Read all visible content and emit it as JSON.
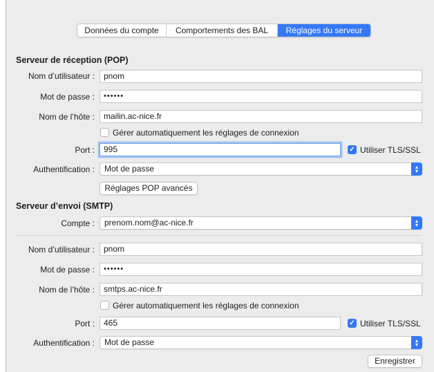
{
  "tabs": [
    {
      "label": "Données du compte",
      "active": false
    },
    {
      "label": "Comportements des BAL",
      "active": false
    },
    {
      "label": "Réglages du serveur",
      "active": true
    }
  ],
  "incoming": {
    "title": "Serveur de réception (POP)",
    "username_label": "Nom d’utilisateur :",
    "username": "pnom",
    "password_label": "Mot de passe :",
    "password": "••••••",
    "host_label": "Nom de l’hôte :",
    "host": "mailin.ac-nice.fr",
    "auto_manage_label": "Gérer automatiquement les réglages de connexion",
    "auto_manage_checked": false,
    "port_label": "Port :",
    "port": "995",
    "tls_label": "Utiliser TLS/SSL",
    "tls_checked": true,
    "auth_label": "Authentification :",
    "auth_value": "Mot de passe",
    "advanced_button": "Réglages POP avancés"
  },
  "outgoing": {
    "title": "Serveur d’envoi (SMTP)",
    "account_label": "Compte :",
    "account_value": "prenom.nom@ac-nice.fr",
    "username_label": "Nom d’utilisateur :",
    "username": "pnom",
    "password_label": "Mot de passe :",
    "password": "••••••",
    "host_label": "Nom de l’hôte :",
    "host": "smtps.ac-nice.fr",
    "auto_manage_label": "Gérer automatiquement les réglages de connexion",
    "auto_manage_checked": false,
    "port_label": "Port :",
    "port": "465",
    "tls_label": "Utiliser TLS/SSL",
    "tls_checked": true,
    "auth_label": "Authentification :",
    "auth_value": "Mot de passe",
    "save_button": "Enregistrer"
  },
  "icons": {
    "check": "✓",
    "select_arrows": "chevron-up-down-icon"
  },
  "colors": {
    "accent": "#3478f6",
    "background": "#ececec"
  }
}
